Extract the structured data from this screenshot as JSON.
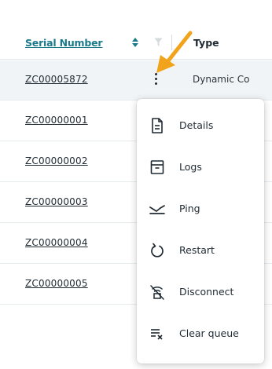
{
  "table": {
    "headers": {
      "serial_number": "Serial Number",
      "type": "Type"
    },
    "rows": [
      {
        "serial": "ZC00005872",
        "type": "Dynamic Co"
      },
      {
        "serial": "ZC00000001",
        "type": ""
      },
      {
        "serial": "ZC00000002",
        "type": ""
      },
      {
        "serial": "ZC00000003",
        "type": ""
      },
      {
        "serial": "ZC00000004",
        "type": ""
      },
      {
        "serial": "ZC00000005",
        "type": ""
      }
    ]
  },
  "row_menu": {
    "items": [
      {
        "label": "Details",
        "icon": "document-icon"
      },
      {
        "label": "Logs",
        "icon": "archive-box-icon"
      },
      {
        "label": "Ping",
        "icon": "ping-signal-icon"
      },
      {
        "label": "Restart",
        "icon": "restart-icon"
      },
      {
        "label": "Disconnect",
        "icon": "disconnect-wifi-icon"
      },
      {
        "label": "Clear queue",
        "icon": "clear-queue-icon"
      }
    ]
  },
  "colors": {
    "header_link": "#1a7a8c",
    "pointer_arrow": "#f2a31c",
    "selected_row": "#f1f4f6"
  }
}
